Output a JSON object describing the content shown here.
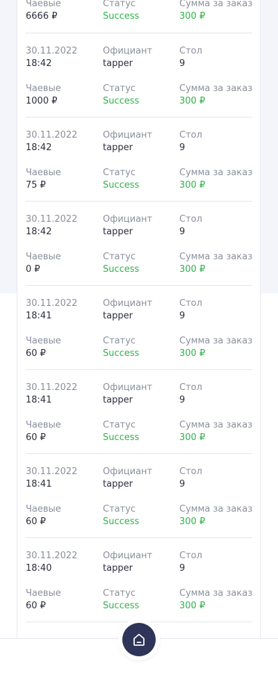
{
  "labels": {
    "tips": "Чаевые",
    "status": "Статус",
    "order_total": "Сумма за заказ",
    "waiter": "Официант",
    "table": "Стол"
  },
  "first_partial": {
    "tips": "6666 ₽",
    "status": "Success",
    "total": "300 ₽"
  },
  "transactions": [
    {
      "date": "30.11.2022",
      "time": "18:42",
      "waiter": "tapper",
      "table": "9",
      "tips": "1000 ₽",
      "status": "Success",
      "total": "300 ₽"
    },
    {
      "date": "30.11.2022",
      "time": "18:42",
      "waiter": "tapper",
      "table": "9",
      "tips": "75 ₽",
      "status": "Success",
      "total": "300 ₽"
    },
    {
      "date": "30.11.2022",
      "time": "18:42",
      "waiter": "tapper",
      "table": "9",
      "tips": "0 ₽",
      "status": "Success",
      "total": "300 ₽"
    },
    {
      "date": "30.11.2022",
      "time": "18:41",
      "waiter": "tapper",
      "table": "9",
      "tips": "60 ₽",
      "status": "Success",
      "total": "300 ₽"
    },
    {
      "date": "30.11.2022",
      "time": "18:41",
      "waiter": "tapper",
      "table": "9",
      "tips": "60 ₽",
      "status": "Success",
      "total": "300 ₽"
    },
    {
      "date": "30.11.2022",
      "time": "18:41",
      "waiter": "tapper",
      "table": "9",
      "tips": "60 ₽",
      "status": "Success",
      "total": "300 ₽"
    },
    {
      "date": "30.11.2022",
      "time": "18:40",
      "waiter": "tapper",
      "table": "9",
      "tips": "60 ₽",
      "status": "Success",
      "total": "300 ₽"
    }
  ],
  "nav": {
    "home_icon": "home-icon"
  },
  "colors": {
    "success": "#2fb24a",
    "nav_button": "#2e3558"
  }
}
